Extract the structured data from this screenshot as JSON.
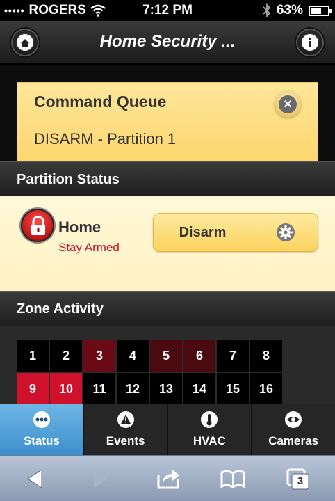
{
  "status_bar": {
    "signal": "•••••",
    "carrier": "ROGERS",
    "time": "7:12 PM",
    "battery": "63%",
    "battery_level": 0.63
  },
  "header": {
    "title": "Home Security ..."
  },
  "command_queue": {
    "title": "Command Queue",
    "item": "DISARM - Partition 1"
  },
  "partition_section": {
    "title": "Partition Status",
    "name": "Home",
    "state": "Stay Armed",
    "disarm_label": "Disarm"
  },
  "zone_section": {
    "title": "Zone Activity",
    "zones": [
      {
        "label": "1",
        "color": "#000000"
      },
      {
        "label": "2",
        "color": "#000000"
      },
      {
        "label": "3",
        "color": "#6a0a14"
      },
      {
        "label": "4",
        "color": "#000000"
      },
      {
        "label": "5",
        "color": "#4a0a10"
      },
      {
        "label": "6",
        "color": "#4a0a10"
      },
      {
        "label": "7",
        "color": "#000000"
      },
      {
        "label": "8",
        "color": "#000000"
      },
      {
        "label": "9",
        "color": "#d0112b"
      },
      {
        "label": "10",
        "color": "#d0112b"
      },
      {
        "label": "11",
        "color": "#000000"
      },
      {
        "label": "12",
        "color": "#000000"
      },
      {
        "label": "13",
        "color": "#000000"
      },
      {
        "label": "14",
        "color": "#000000"
      },
      {
        "label": "15",
        "color": "#000000"
      },
      {
        "label": "16",
        "color": "#000000"
      }
    ]
  },
  "tabs": [
    {
      "label": "Status",
      "icon": "dots-icon",
      "active": true
    },
    {
      "label": "Events",
      "icon": "warning-icon",
      "active": false
    },
    {
      "label": "HVAC",
      "icon": "thermometer-icon",
      "active": false
    },
    {
      "label": "Cameras",
      "icon": "eye-icon",
      "active": false
    }
  ],
  "browser_toolbar": {
    "tabs_count": "3"
  },
  "colors": {
    "accent_blue": "#4a9bd6",
    "alert_red": "#d0112b",
    "card_yellow": "#fdd66e"
  }
}
